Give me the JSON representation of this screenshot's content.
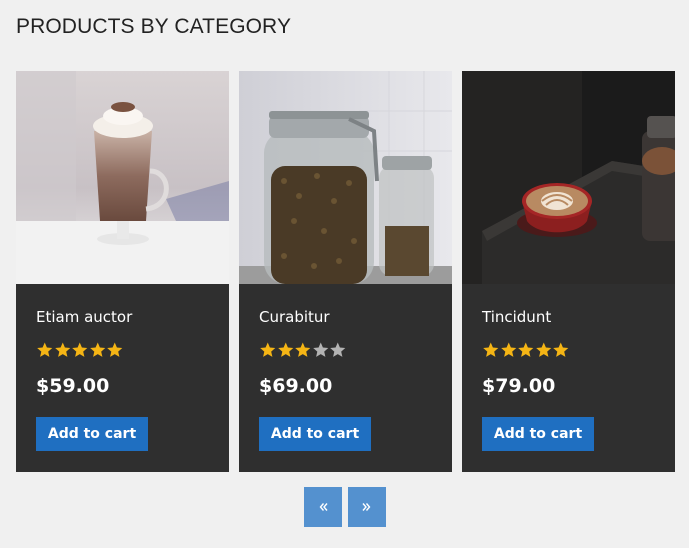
{
  "page": {
    "title": "PRODUCTS BY CATEGORY"
  },
  "products": [
    {
      "name": "Etiam auctor",
      "price": "$59.00",
      "rating": 5,
      "rating_max": 5,
      "button_label": "Add to cart",
      "image": "iced-latte-glass"
    },
    {
      "name": "Curabitur",
      "price": "$69.00",
      "rating": 3,
      "rating_max": 5,
      "button_label": "Add to cart",
      "image": "coffee-bean-jars"
    },
    {
      "name": "Tincidunt",
      "price": "$79.00",
      "rating": 5,
      "rating_max": 5,
      "button_label": "Add to cart",
      "image": "latte-art-cup"
    }
  ],
  "pager": {
    "prev_icon": "double-chevron-left-icon",
    "next_icon": "double-chevron-right-icon"
  },
  "colors": {
    "background": "#f0f0f0",
    "card": "#2f2f2f",
    "button": "#1f6fc1",
    "pager_button": "#5491cf",
    "star_filled": "#f5b515",
    "star_empty": "#b3b3b3"
  }
}
